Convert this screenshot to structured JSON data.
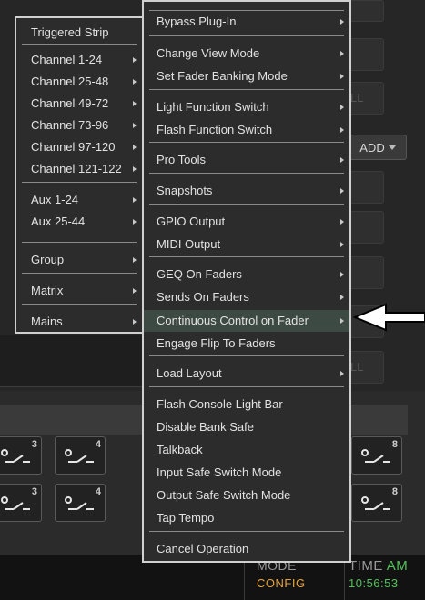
{
  "submenu": {
    "items": [
      {
        "label": "Triggered Strip",
        "arrow": false
      },
      {
        "label": "Channel 1-24",
        "arrow": true
      },
      {
        "label": "Channel 25-48",
        "arrow": true
      },
      {
        "label": "Channel 49-72",
        "arrow": true
      },
      {
        "label": "Channel 73-96",
        "arrow": true
      },
      {
        "label": "Channel 97-120",
        "arrow": true
      },
      {
        "label": "Channel 121-122",
        "arrow": true
      },
      {
        "label": "Aux 1-24",
        "arrow": true
      },
      {
        "label": "Aux 25-44",
        "arrow": true
      },
      {
        "label": "Group",
        "arrow": true
      },
      {
        "label": "Matrix",
        "arrow": true
      },
      {
        "label": "Mains",
        "arrow": true
      }
    ]
  },
  "menu": {
    "items": [
      {
        "label": "Bypass Plug-In",
        "arrow": true
      },
      {
        "label": "Change View Mode",
        "arrow": true
      },
      {
        "label": "Set Fader Banking Mode",
        "arrow": true
      },
      {
        "label": "Light Function Switch",
        "arrow": true
      },
      {
        "label": "Flash Function Switch",
        "arrow": true
      },
      {
        "label": "Pro Tools",
        "arrow": true
      },
      {
        "label": "Snapshots",
        "arrow": true
      },
      {
        "label": "GPIO Output",
        "arrow": true
      },
      {
        "label": "MIDI Output",
        "arrow": true
      },
      {
        "label": "GEQ On Faders",
        "arrow": true
      },
      {
        "label": "Sends On Faders",
        "arrow": true
      },
      {
        "label": "Continuous Control on Fader",
        "arrow": true,
        "highlighted": true
      },
      {
        "label": "Engage Flip To Faders",
        "arrow": false
      },
      {
        "label": "Load Layout",
        "arrow": true
      },
      {
        "label": "Flash Console Light Bar",
        "arrow": false
      },
      {
        "label": "Disable Bank Safe",
        "arrow": false
      },
      {
        "label": "Talkback",
        "arrow": false
      },
      {
        "label": "Input Safe Switch Mode",
        "arrow": false
      },
      {
        "label": "Output Safe Switch Mode",
        "arrow": false
      },
      {
        "label": "Tap Tempo",
        "arrow": false
      },
      {
        "label": "Cancel Operation",
        "arrow": false
      }
    ]
  },
  "background": {
    "add_label": "ADD",
    "right_partial_1": "LL",
    "right_partial_2": "LL",
    "switches_row1": [
      "3",
      "4",
      "8"
    ],
    "switches_row2": [
      "3",
      "4",
      "8"
    ]
  },
  "status": {
    "mode_label": "MODE",
    "mode_value": "CONFIG",
    "time_label": "TIME",
    "time_suffix": "AM",
    "time_value": "10:56:53"
  },
  "colors": {
    "mode_value": "#e8a43a",
    "time_suffix": "#52c15a",
    "time_value": "#52c15a",
    "highlight": "#3d4943"
  }
}
